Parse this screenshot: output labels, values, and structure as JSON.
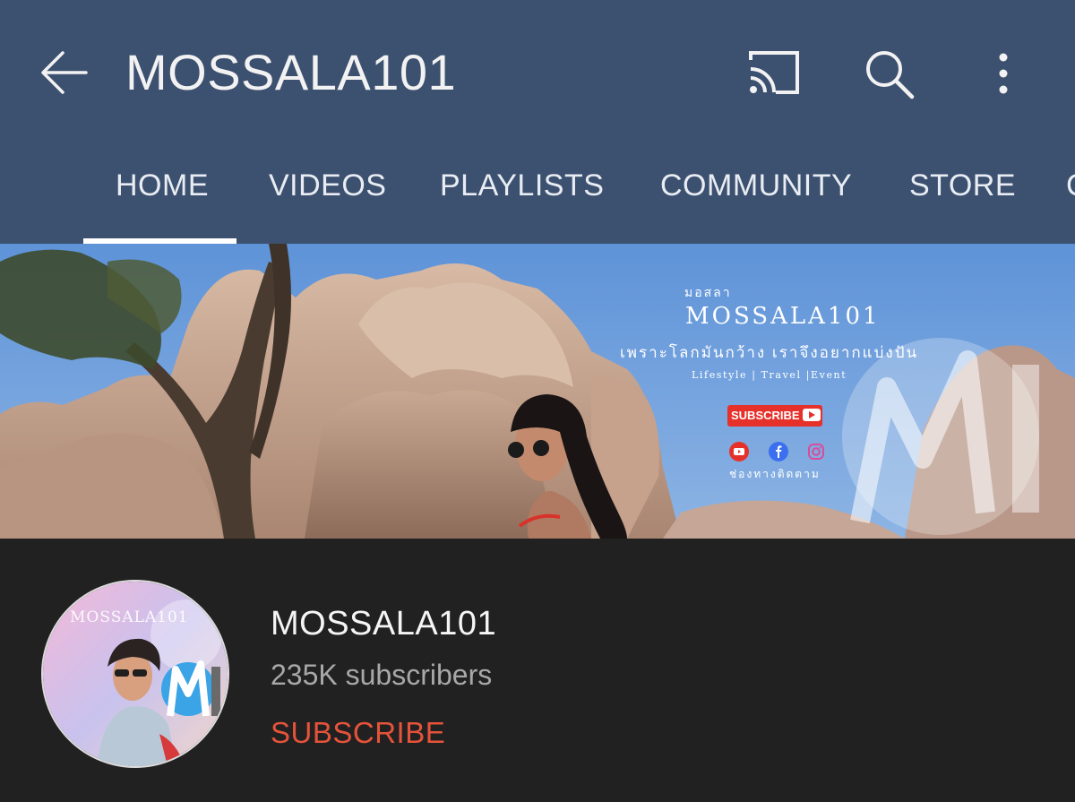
{
  "appbar": {
    "title": "MOSSALA101",
    "icons": [
      "back-arrow-icon",
      "cast-icon",
      "search-icon",
      "more-vert-icon"
    ]
  },
  "tabs": [
    {
      "label": "HOME",
      "selected": true
    },
    {
      "label": "VIDEOS",
      "selected": false
    },
    {
      "label": "PLAYLISTS",
      "selected": false
    },
    {
      "label": "COMMUNITY",
      "selected": false
    },
    {
      "label": "STORE",
      "selected": false
    }
  ],
  "banner": {
    "brand_small": "มอสลา",
    "brand": "MOSSALA101",
    "tagline": "เพราะโลกมันกว้าง เราจึงอยากแบ่งปัน",
    "categories": "Lifestyle | Travel |Event",
    "subscribe_label": "SUBSCRIBE",
    "follow_text": "ช่องทางติดตาม",
    "social_icons": [
      "youtube-icon",
      "facebook-icon",
      "instagram-icon"
    ]
  },
  "channel": {
    "name": "MOSSALA101",
    "subscribers": "235K subscribers",
    "subscribe_label": "SUBSCRIBE",
    "avatar_text": "MOSSALA101"
  },
  "colors": {
    "header_bg": "#3c5070",
    "body_bg": "#212121",
    "subscribe": "#e5533a"
  }
}
